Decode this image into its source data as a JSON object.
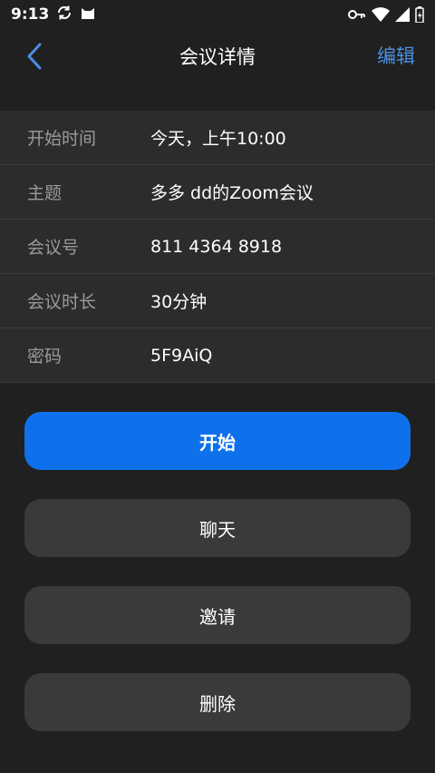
{
  "status_bar": {
    "time": "9:13",
    "icons": [
      "sync-icon",
      "cat-icon",
      "key-icon",
      "wifi-icon",
      "signal-icon",
      "battery-icon"
    ]
  },
  "header": {
    "title": "会议详情",
    "edit_label": "编辑",
    "accent_color": "#4a90e2"
  },
  "details": [
    {
      "label": "开始时间",
      "value": "今天，上午10:00"
    },
    {
      "label": "主题",
      "value": "多多 dd的Zoom会议"
    },
    {
      "label": "会议号",
      "value": "811 4364 8918"
    },
    {
      "label": "会议时长",
      "value": "30分钟"
    },
    {
      "label": "密码",
      "value": "5F9AiQ"
    }
  ],
  "actions": {
    "start": "开始",
    "chat": "聊天",
    "invite": "邀请",
    "delete": "删除",
    "primary_color": "#0e71eb"
  }
}
